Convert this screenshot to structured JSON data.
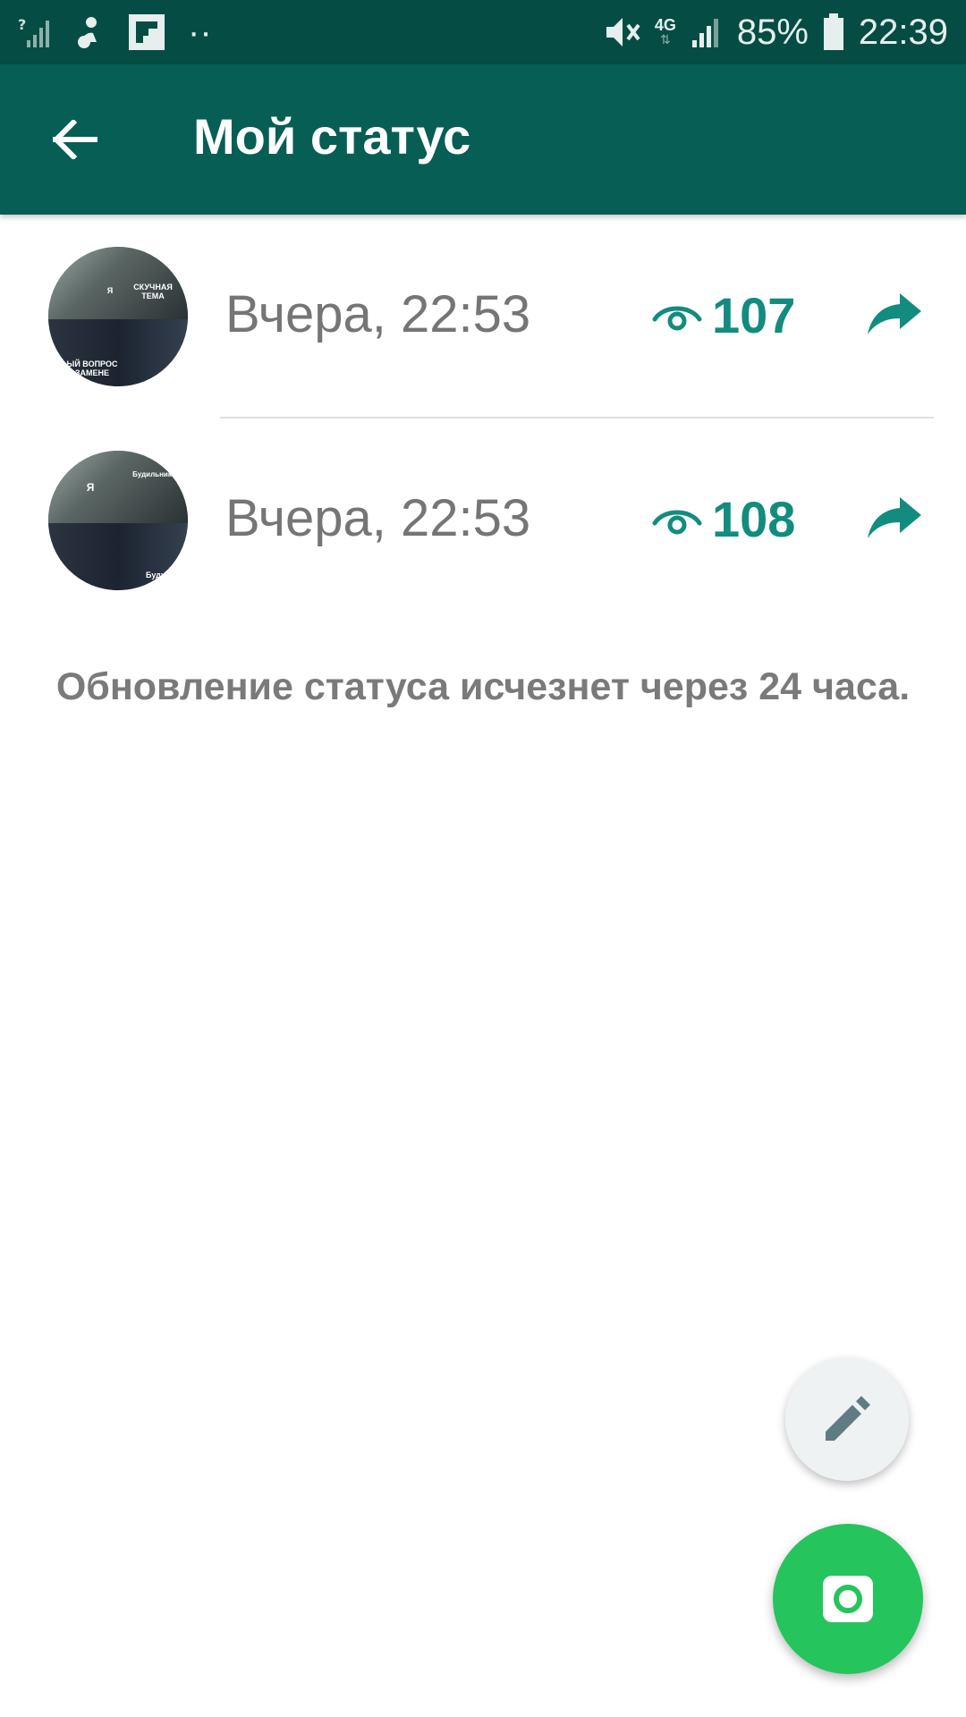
{
  "status_bar": {
    "battery_percent": "85%",
    "time": "22:39",
    "network": "4G",
    "dots": "··"
  },
  "appbar": {
    "title": "Мой статус"
  },
  "statuses": [
    {
      "time": "Вчера, 22:53",
      "views": "107",
      "thumb_caption_top": "СКУЧНАЯ ТЕМА",
      "thumb_caption_left": "Я",
      "thumb_caption_bottom": "ЫЙ ВОПРОС ЗАМЕНЕ"
    },
    {
      "time": "Вчера, 22:53",
      "views": "108",
      "thumb_caption_top": "Будильник",
      "thumb_caption_left": "Я",
      "thumb_caption_bottom": "Буду"
    }
  ],
  "note": "Обновление статуса исчезнет через 24 часа.",
  "colors": {
    "primary_dark": "#054d44",
    "primary": "#075e54",
    "accent": "#128c7e",
    "fab_camera": "#25c45c"
  },
  "icons": {
    "back": "arrow-left-icon",
    "eye": "eye-icon",
    "share": "share-icon",
    "edit": "pencil-icon",
    "camera": "camera-icon"
  }
}
